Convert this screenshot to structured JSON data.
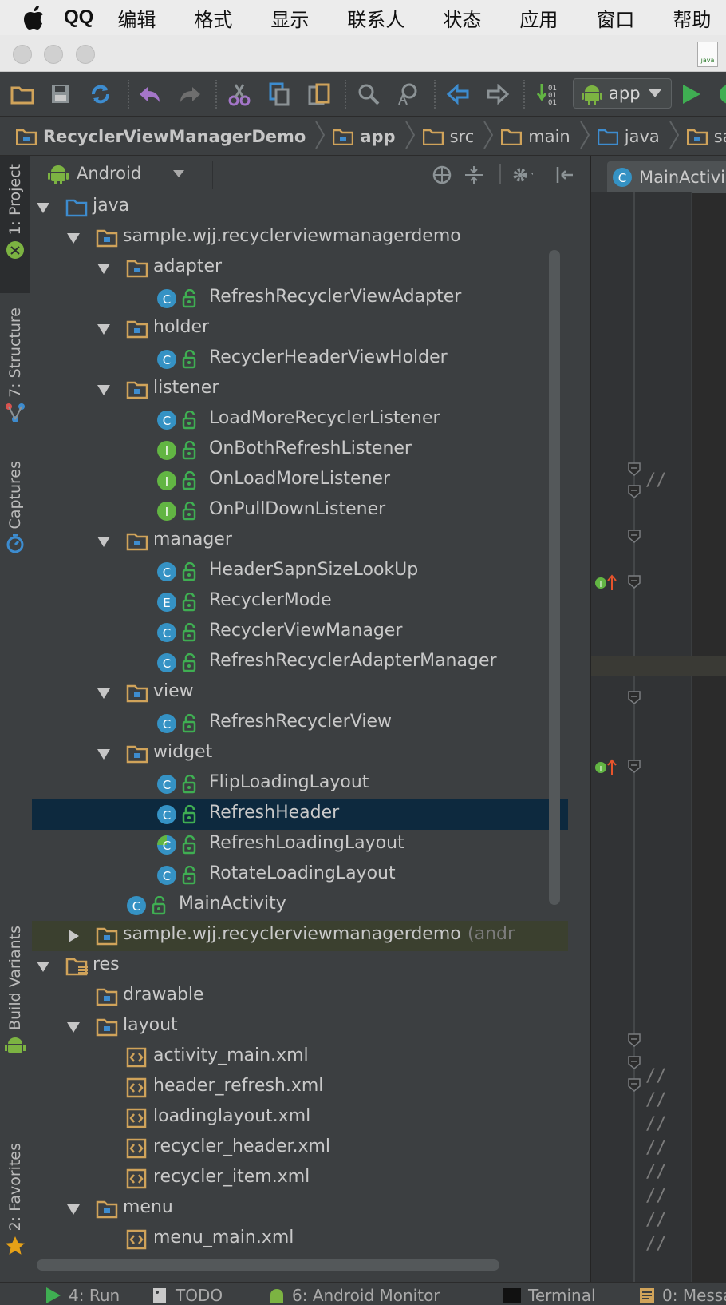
{
  "menubar": {
    "app_name": "QQ",
    "items": [
      "编辑",
      "格式",
      "显示",
      "联系人",
      "状态",
      "应用",
      "窗口",
      "帮助"
    ]
  },
  "titlebar": {
    "file_icon_label": "java"
  },
  "toolbar": {
    "run_config": "app"
  },
  "breadcrumb": {
    "items": [
      "RecyclerViewManagerDemo",
      "app",
      "src",
      "main",
      "java",
      "samp"
    ]
  },
  "sidebar": {
    "tabs": [
      "1: Project",
      "7: Structure",
      "Captures",
      "Build Variants",
      "2: Favorites"
    ]
  },
  "project_panel": {
    "view_mode": "Android",
    "tree": [
      {
        "label": "java",
        "kind": "folder-src",
        "expanded": true
      },
      {
        "label": "sample.wjj.recyclerviewmanagerdemo",
        "kind": "package",
        "expanded": true
      },
      {
        "label": "adapter",
        "kind": "package",
        "expanded": true
      },
      {
        "label": "RefreshRecyclerViewAdapter",
        "kind": "class"
      },
      {
        "label": "holder",
        "kind": "package",
        "expanded": true
      },
      {
        "label": "RecyclerHeaderViewHolder",
        "kind": "class"
      },
      {
        "label": "listener",
        "kind": "package",
        "expanded": true
      },
      {
        "label": "LoadMoreRecyclerListener",
        "kind": "class"
      },
      {
        "label": "OnBothRefreshListener",
        "kind": "interface"
      },
      {
        "label": "OnLoadMoreListener",
        "kind": "interface"
      },
      {
        "label": "OnPullDownListener",
        "kind": "interface"
      },
      {
        "label": "manager",
        "kind": "package",
        "expanded": true
      },
      {
        "label": "HeaderSapnSizeLookUp",
        "kind": "class"
      },
      {
        "label": "RecyclerMode",
        "kind": "enum"
      },
      {
        "label": "RecyclerViewManager",
        "kind": "class"
      },
      {
        "label": "RefreshRecyclerAdapterManager",
        "kind": "class"
      },
      {
        "label": "view",
        "kind": "package",
        "expanded": true
      },
      {
        "label": "RefreshRecyclerView",
        "kind": "class"
      },
      {
        "label": "widget",
        "kind": "package",
        "expanded": true
      },
      {
        "label": "FlipLoadingLayout",
        "kind": "class"
      },
      {
        "label": "RefreshHeader",
        "kind": "class",
        "selected": true
      },
      {
        "label": "RefreshLoadingLayout",
        "kind": "abstract-class"
      },
      {
        "label": "RotateLoadingLayout",
        "kind": "class"
      },
      {
        "label": "MainActivity",
        "kind": "class"
      },
      {
        "label": "sample.wjj.recyclerviewmanagerdemo",
        "suffix": "(andr",
        "kind": "package",
        "collapsed": true
      },
      {
        "label": "res",
        "kind": "folder-res",
        "expanded": true
      },
      {
        "label": "drawable",
        "kind": "package"
      },
      {
        "label": "layout",
        "kind": "package",
        "expanded": true
      },
      {
        "label": "activity_main.xml",
        "kind": "xml"
      },
      {
        "label": "header_refresh.xml",
        "kind": "xml"
      },
      {
        "label": "loadinglayout.xml",
        "kind": "xml"
      },
      {
        "label": "recycler_header.xml",
        "kind": "xml"
      },
      {
        "label": "recycler_item.xml",
        "kind": "xml"
      },
      {
        "label": "menu",
        "kind": "package",
        "expanded": true
      },
      {
        "label": "menu_main.xml",
        "kind": "xml"
      }
    ]
  },
  "editor": {
    "tab_title": "MainActivi",
    "comment_marker": "//"
  },
  "bottom_tabs": [
    "4: Run",
    "TODO",
    "6: Android Monitor",
    "Terminal",
    "0: Messa"
  ],
  "colors": {
    "accent_selected": "#0d293e",
    "class_icon": "#3592c4",
    "interface_icon": "#62b543",
    "folder": "#d0a35a"
  }
}
